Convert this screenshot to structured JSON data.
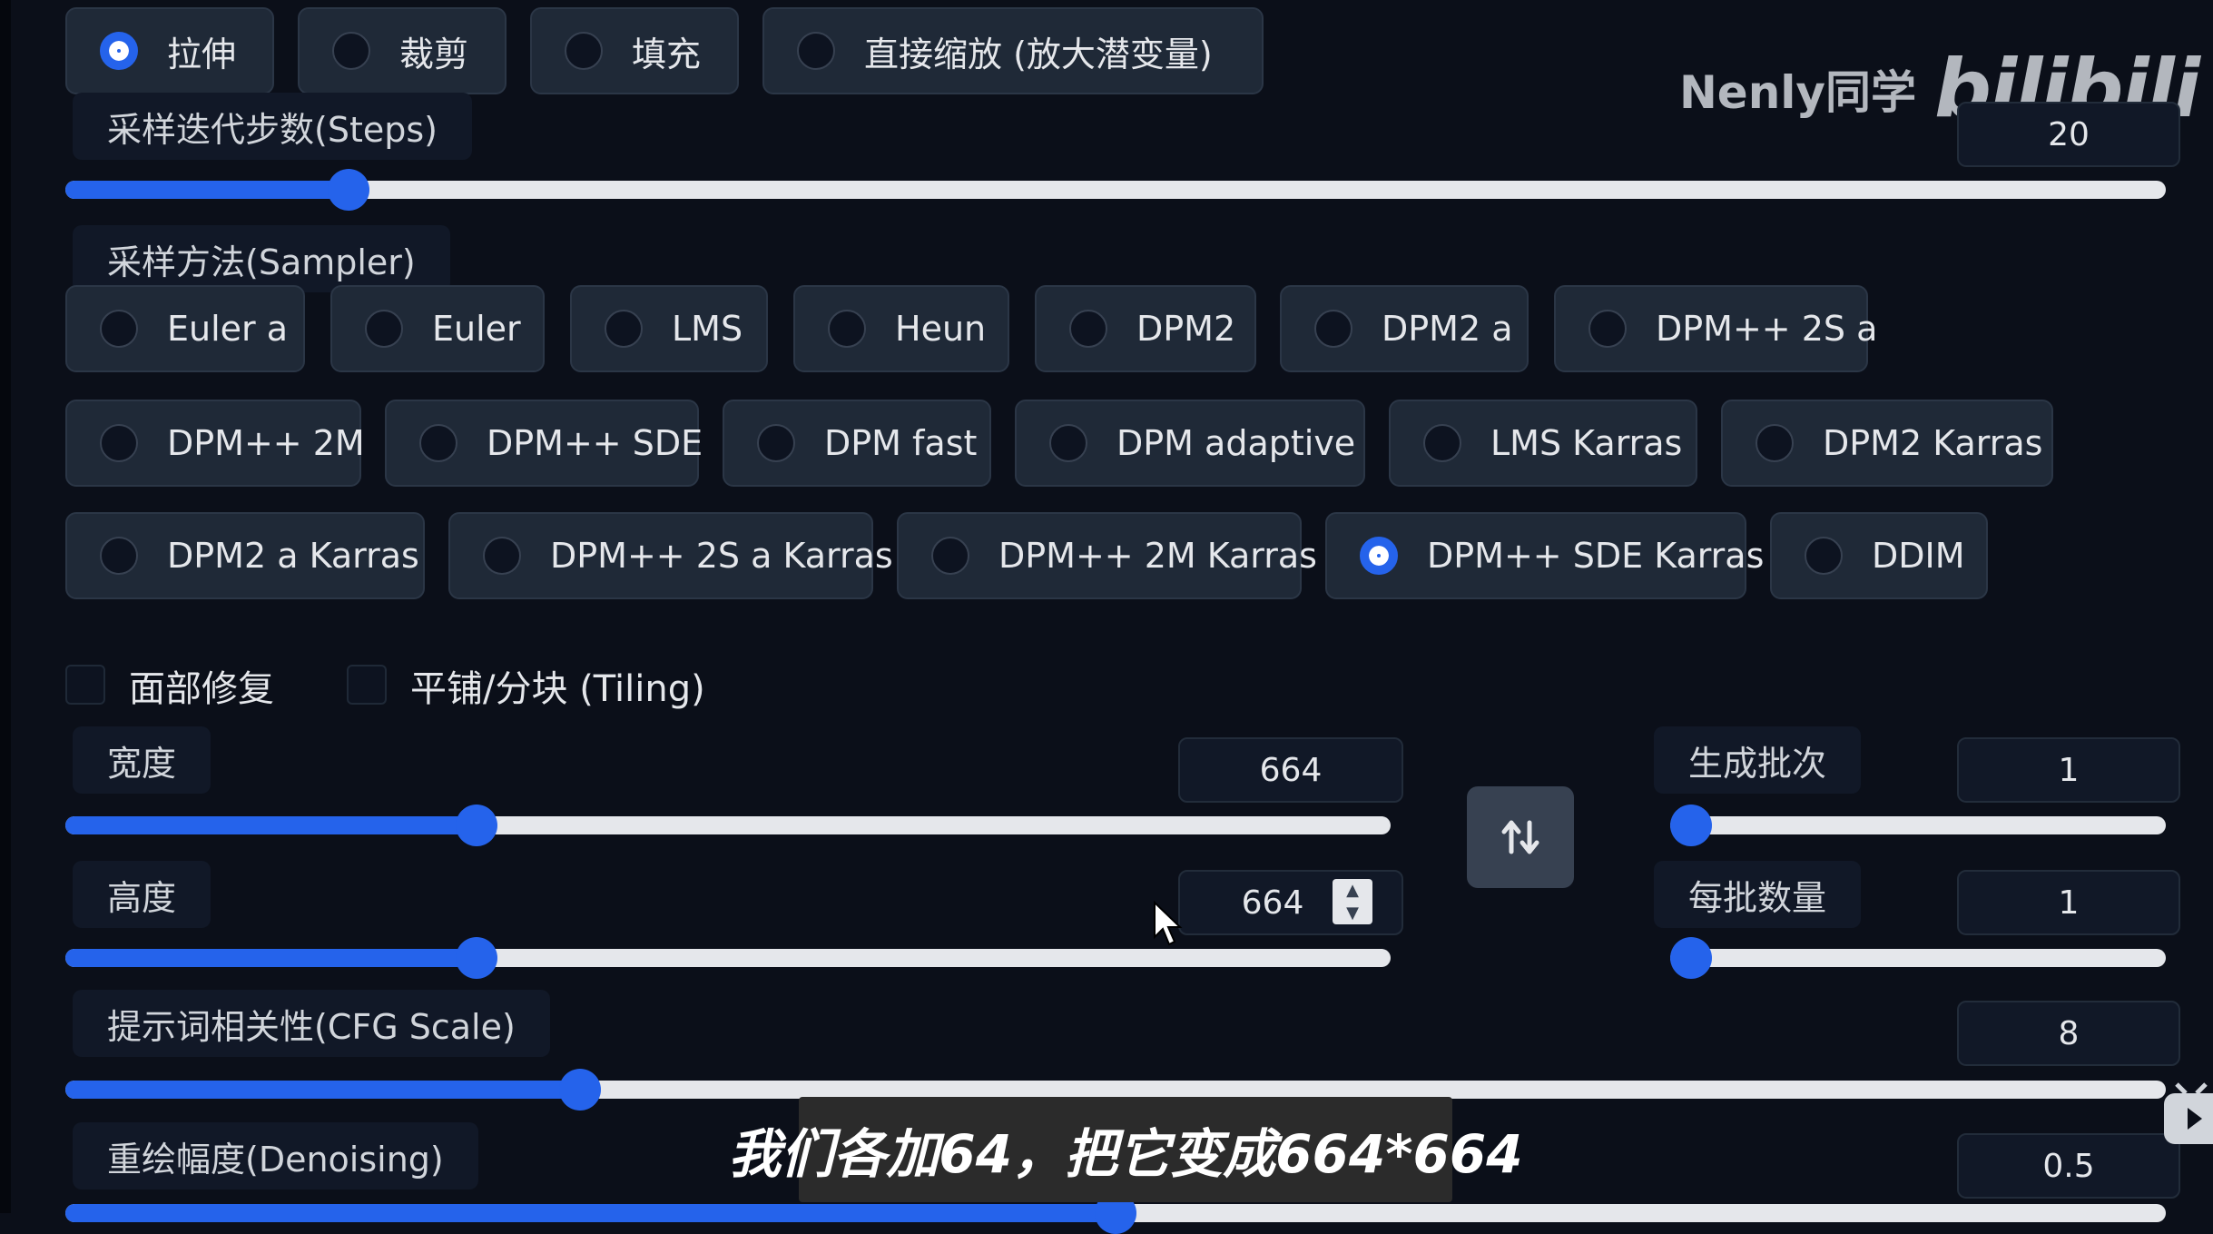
{
  "resize_mode": {
    "options": [
      "拉伸",
      "裁剪",
      "填充",
      "直接缩放 (放大潜变量)"
    ],
    "selected": "拉伸"
  },
  "steps": {
    "label": "采样迭代步数(Steps)",
    "value": "20",
    "fraction": 0.135
  },
  "sampler": {
    "label": "采样方法(Sampler)",
    "options": [
      "Euler a",
      "Euler",
      "LMS",
      "Heun",
      "DPM2",
      "DPM2 a",
      "DPM++ 2S a",
      "DPM++ 2M",
      "DPM++ SDE",
      "DPM fast",
      "DPM adaptive",
      "LMS Karras",
      "DPM2 Karras",
      "DPM2 a Karras",
      "DPM++ 2S a Karras",
      "DPM++ 2M Karras",
      "DPM++ SDE Karras",
      "DDIM"
    ],
    "selected": "DPM++ SDE Karras"
  },
  "checkboxes": {
    "face_restore": "面部修复",
    "tiling": "平铺/分块 (Tiling)"
  },
  "width": {
    "label": "宽度",
    "value": "664",
    "fraction": 0.31
  },
  "height": {
    "label": "高度",
    "value": "664",
    "fraction": 0.31
  },
  "batch_count": {
    "label": "生成批次",
    "value": "1",
    "fraction": 0.0
  },
  "batch_size": {
    "label": "每批数量",
    "value": "1",
    "fraction": 0.0
  },
  "cfg_scale": {
    "label": "提示词相关性(CFG Scale)",
    "value": "8",
    "fraction": 0.245
  },
  "denoising": {
    "label": "重绘幅度(Denoising)",
    "value": "0.5",
    "fraction": 0.5
  },
  "overlay": {
    "watermark_name": "Nenly同学",
    "watermark_logo": "bilibili",
    "subtitle": "我们各加64，把它变成664*664"
  },
  "colors": {
    "accent": "#2563eb",
    "panel": "#1f2937",
    "background": "#0b0f19"
  },
  "icons": [
    "swap-icon",
    "cursor-icon",
    "spinner-icon",
    "tv-icon"
  ]
}
